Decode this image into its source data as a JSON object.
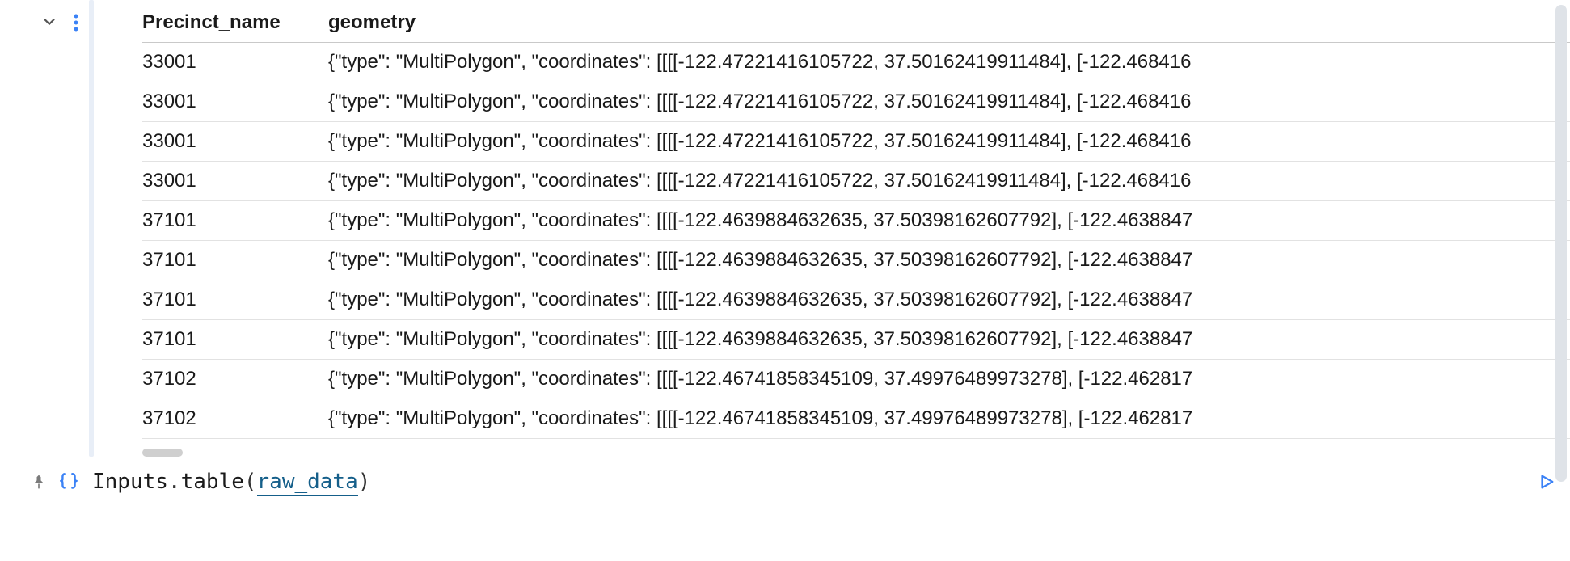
{
  "table": {
    "headers": {
      "precinct": "Precinct_name",
      "geometry": "geometry"
    },
    "rows": [
      {
        "precinct": "33001",
        "geometry": "{\"type\": \"MultiPolygon\", \"coordinates\": [[[[-122.47221416105722, 37.50162419911484], [-122.468416"
      },
      {
        "precinct": "33001",
        "geometry": "{\"type\": \"MultiPolygon\", \"coordinates\": [[[[-122.47221416105722, 37.50162419911484], [-122.468416"
      },
      {
        "precinct": "33001",
        "geometry": "{\"type\": \"MultiPolygon\", \"coordinates\": [[[[-122.47221416105722, 37.50162419911484], [-122.468416"
      },
      {
        "precinct": "33001",
        "geometry": "{\"type\": \"MultiPolygon\", \"coordinates\": [[[[-122.47221416105722, 37.50162419911484], [-122.468416"
      },
      {
        "precinct": "37101",
        "geometry": "{\"type\": \"MultiPolygon\", \"coordinates\": [[[[-122.4639884632635, 37.50398162607792], [-122.4638847"
      },
      {
        "precinct": "37101",
        "geometry": "{\"type\": \"MultiPolygon\", \"coordinates\": [[[[-122.4639884632635, 37.50398162607792], [-122.4638847"
      },
      {
        "precinct": "37101",
        "geometry": "{\"type\": \"MultiPolygon\", \"coordinates\": [[[[-122.4639884632635, 37.50398162607792], [-122.4638847"
      },
      {
        "precinct": "37101",
        "geometry": "{\"type\": \"MultiPolygon\", \"coordinates\": [[[[-122.4639884632635, 37.50398162607792], [-122.4638847"
      },
      {
        "precinct": "37102",
        "geometry": "{\"type\": \"MultiPolygon\", \"coordinates\": [[[[-122.46741858345109, 37.49976489973278], [-122.462817"
      },
      {
        "precinct": "37102",
        "geometry": "{\"type\": \"MultiPolygon\", \"coordinates\": [[[[-122.46741858345109, 37.49976489973278], [-122.462817"
      }
    ]
  },
  "code": {
    "ident": "Inputs",
    "dot": ".",
    "method": "table",
    "open": "(",
    "var": "raw_data",
    "close": ")"
  }
}
